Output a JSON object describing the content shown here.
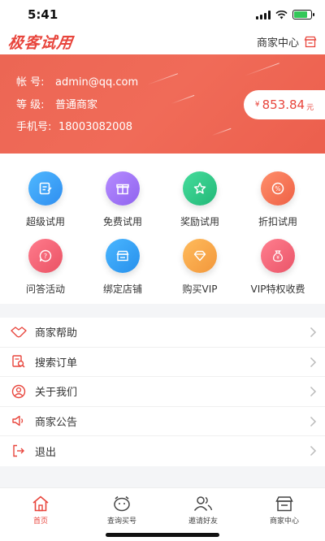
{
  "status_bar": {
    "time": "5:41"
  },
  "header": {
    "logo_text": "极客试用",
    "merchant_center_label": "商家中心"
  },
  "account": {
    "rows": [
      {
        "label": "帐 号:",
        "value": "admin@qq.com"
      },
      {
        "label": "等 级:",
        "value": "普通商家"
      },
      {
        "label": "手机号:",
        "value": "18003082008"
      }
    ],
    "balance": {
      "currency": "¥",
      "amount": "853.84",
      "unit": "元"
    }
  },
  "features": [
    {
      "label": "超级试用",
      "icon": "edit-icon",
      "color": "#3ea8f5"
    },
    {
      "label": "免费试用",
      "icon": "gift-icon",
      "color": "#a37af3"
    },
    {
      "label": "奖励试用",
      "icon": "star-icon",
      "color": "#34c98a"
    },
    {
      "label": "折扣试用",
      "icon": "discount-icon",
      "color": "#f47a5a"
    },
    {
      "label": "问答活动",
      "icon": "question-icon",
      "color": "#f0687a"
    },
    {
      "label": "绑定店铺",
      "icon": "store-icon",
      "color": "#3aa3f0"
    },
    {
      "label": "购买VIP",
      "icon": "diamond-icon",
      "color": "#f7a64a"
    },
    {
      "label": "VIP特权收费",
      "icon": "money-bag-icon",
      "color": "#f2697a"
    }
  ],
  "menu": [
    {
      "label": "商家帮助",
      "icon": "handshake-icon"
    },
    {
      "label": "搜索订单",
      "icon": "search-order-icon"
    },
    {
      "label": "关于我们",
      "icon": "user-circle-icon"
    },
    {
      "label": "商家公告",
      "icon": "megaphone-icon"
    },
    {
      "label": "退出",
      "icon": "logout-icon"
    }
  ],
  "tabs": [
    {
      "label": "首页",
      "icon": "home-icon",
      "active": true
    },
    {
      "label": "查询买号",
      "icon": "query-icon",
      "active": false
    },
    {
      "label": "邀请好友",
      "icon": "friends-icon",
      "active": false
    },
    {
      "label": "商家中心",
      "icon": "shop-icon",
      "active": false
    }
  ],
  "colors": {
    "accent": "#e8453c",
    "banner": "#ec6654"
  }
}
